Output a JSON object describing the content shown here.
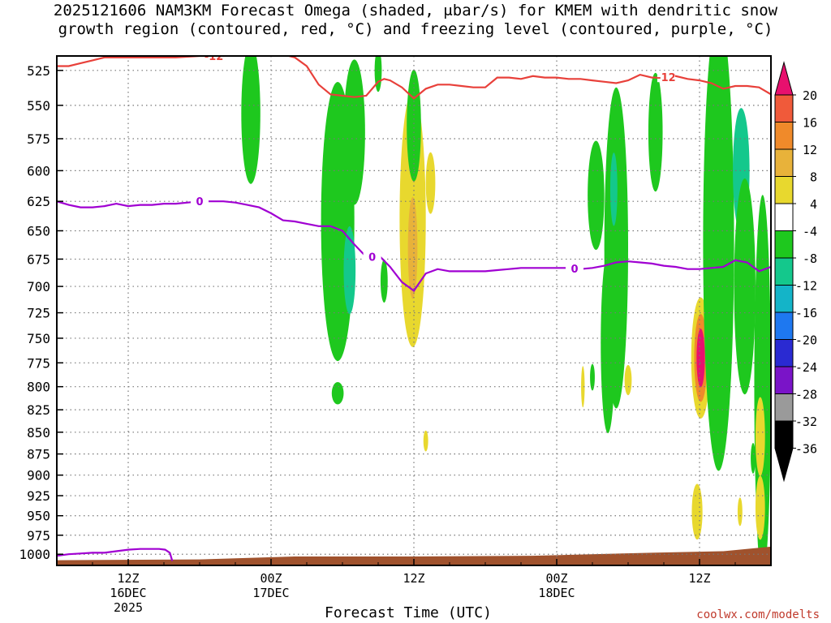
{
  "title": {
    "line1": "2025121606 NAM3KM Forecast Omega (shaded, μbar/s) for KMEM with dendritic snow",
    "line2": "growth region (contoured, red, °C) and freezing level (contoured, purple, °C)"
  },
  "credit": "coolwx.com/modelts",
  "chart_data": {
    "type": "heatmap",
    "xlabel": "Forecast Time (UTC)",
    "ylabel": "",
    "x_units": "forecast hour",
    "xlim": [
      0,
      60
    ],
    "ylim": [
      1015,
      515
    ],
    "y_ticks": [
      525,
      550,
      575,
      600,
      625,
      650,
      675,
      700,
      725,
      750,
      775,
      800,
      825,
      850,
      875,
      900,
      925,
      950,
      975,
      1000
    ],
    "x_ticks": [
      {
        "hour": 6,
        "lines": [
          "12Z",
          "16DEC",
          "2025"
        ]
      },
      {
        "hour": 18,
        "lines": [
          "00Z",
          "17DEC"
        ]
      },
      {
        "hour": 30,
        "lines": [
          "12Z"
        ]
      },
      {
        "hour": 42,
        "lines": [
          "00Z",
          "18DEC"
        ]
      },
      {
        "hour": 54,
        "lines": [
          "12Z"
        ]
      }
    ],
    "grid": true,
    "colorbar": {
      "levels": [
        20,
        16,
        12,
        8,
        4,
        -4,
        -8,
        -12,
        -16,
        -20,
        -24,
        -28,
        -32,
        -36
      ],
      "colors": [
        "#e8106e",
        "#f05a3a",
        "#f08a2a",
        "#e8b23a",
        "#e8d82e",
        "#ffffff",
        "#1ec81e",
        "#14c88c",
        "#14b4c8",
        "#1e78f0",
        "#2a2ad2",
        "#7a14c8",
        "#9a9a9a",
        "#000000"
      ]
    },
    "series": [
      {
        "name": "-12",
        "color": "#e8403a",
        "x": [
          0,
          1,
          2,
          3,
          4,
          6,
          8,
          10,
          12,
          14,
          16,
          18,
          19,
          20,
          21,
          22,
          23,
          24,
          25,
          26,
          27,
          27.5,
          28,
          29,
          30,
          31,
          32,
          33,
          34,
          35,
          36,
          37,
          38,
          39,
          40,
          41,
          42,
          43,
          44,
          45,
          46,
          47,
          48,
          49,
          50,
          51,
          52,
          53,
          54,
          55,
          56,
          57,
          58,
          59,
          60
        ],
        "y": [
          522,
          522,
          520,
          518,
          516,
          516,
          516,
          516,
          515,
          515,
          514,
          514,
          514,
          516,
          522,
          535,
          542,
          543,
          544,
          543,
          533,
          531,
          532,
          537,
          545,
          538,
          535,
          535,
          536,
          537,
          537,
          530,
          530,
          531,
          529,
          530,
          530,
          531,
          531,
          532,
          533,
          534,
          532,
          528,
          530,
          530,
          529,
          531,
          532,
          534,
          538,
          536,
          536,
          537,
          542
        ]
      },
      {
        "name": "0",
        "color": "#a000d2",
        "x": [
          0,
          1,
          2,
          3,
          4,
          5,
          6,
          7,
          8,
          9,
          10,
          11,
          12,
          13,
          14,
          15,
          16,
          17,
          18,
          19,
          20,
          21,
          22,
          23,
          24,
          25,
          26,
          26.5,
          27,
          28,
          29,
          30,
          31,
          32,
          33,
          34,
          35,
          36,
          37,
          38,
          39,
          40,
          41,
          42,
          43,
          44,
          45,
          46,
          47,
          48,
          49,
          50,
          51,
          52,
          53,
          54,
          55,
          56,
          57,
          58,
          59,
          60
        ],
        "y": [
          625,
          628,
          630,
          630,
          629,
          627,
          629,
          628,
          628,
          627,
          627,
          626,
          625,
          625,
          625,
          626,
          628,
          630,
          635,
          641,
          642,
          644,
          646,
          646,
          650,
          662,
          673,
          673,
          671,
          682,
          696,
          704,
          688,
          684,
          686,
          686,
          686,
          686,
          685,
          684,
          683,
          683,
          683,
          683,
          683,
          684,
          683,
          681,
          678,
          677,
          678,
          679,
          681,
          682,
          684,
          684,
          683,
          682,
          676,
          678,
          686,
          682
        ]
      },
      {
        "name": "0b",
        "color": "#a000d2",
        "x": [
          0,
          1,
          2,
          3,
          4,
          5,
          6,
          7,
          8,
          8.6,
          9.1,
          9.5,
          9.7
        ],
        "y": [
          1002,
          1000,
          999,
          998,
          998,
          996,
          994,
          993,
          993,
          993,
          994,
          998,
          1009
        ]
      }
    ]
  },
  "blobs": [
    {
      "x": 16.3,
      "y": 556,
      "rx": 0.8,
      "ry": 52,
      "color": "#1ec81e"
    },
    {
      "x": 23.6,
      "y": 642,
      "rx": 1.4,
      "ry": 118,
      "color": "#1ec81e"
    },
    {
      "x": 25.0,
      "y": 570,
      "rx": 0.9,
      "ry": 55,
      "color": "#1ec81e"
    },
    {
      "x": 24.6,
      "y": 685,
      "rx": 0.5,
      "ry": 40,
      "color": "#14c88c"
    },
    {
      "x": 23.6,
      "y": 807,
      "rx": 0.5,
      "ry": 12,
      "color": "#1ec81e"
    },
    {
      "x": 29.9,
      "y": 640,
      "rx": 1.1,
      "ry": 108,
      "color": "#e8d82e"
    },
    {
      "x": 29.9,
      "y": 665,
      "rx": 0.4,
      "ry": 45,
      "color": "#e8b23a"
    },
    {
      "x": 30.0,
      "y": 565,
      "rx": 0.6,
      "ry": 42,
      "color": "#1ec81e"
    },
    {
      "x": 27.0,
      "y": 525,
      "rx": 0.3,
      "ry": 15,
      "color": "#1ec81e"
    },
    {
      "x": 27.5,
      "y": 695,
      "rx": 0.3,
      "ry": 20,
      "color": "#1ec81e"
    },
    {
      "x": 31.4,
      "y": 610,
      "rx": 0.4,
      "ry": 25,
      "color": "#e8d82e"
    },
    {
      "x": 31.0,
      "y": 860,
      "rx": 0.2,
      "ry": 12,
      "color": "#e8d82e"
    },
    {
      "x": 45.3,
      "y": 620,
      "rx": 0.7,
      "ry": 45,
      "color": "#1ec81e"
    },
    {
      "x": 47.0,
      "y": 665,
      "rx": 1.0,
      "ry": 140,
      "color": "#1ec81e"
    },
    {
      "x": 46.8,
      "y": 615,
      "rx": 0.3,
      "ry": 30,
      "color": "#14c88c"
    },
    {
      "x": 46.3,
      "y": 755,
      "rx": 0.6,
      "ry": 90,
      "color": "#1ec81e"
    },
    {
      "x": 45.0,
      "y": 790,
      "rx": 0.2,
      "ry": 14,
      "color": "#1ec81e"
    },
    {
      "x": 44.2,
      "y": 800,
      "rx": 0.15,
      "ry": 22,
      "color": "#e8d82e"
    },
    {
      "x": 50.3,
      "y": 570,
      "rx": 0.6,
      "ry": 45,
      "color": "#1ec81e"
    },
    {
      "x": 48.0,
      "y": 793,
      "rx": 0.3,
      "ry": 16,
      "color": "#e8d82e"
    },
    {
      "x": 54.1,
      "y": 770,
      "rx": 0.8,
      "ry": 62,
      "color": "#e8d82e"
    },
    {
      "x": 54.1,
      "y": 770,
      "rx": 0.55,
      "ry": 45,
      "color": "#f08a2a"
    },
    {
      "x": 54.1,
      "y": 770,
      "rx": 0.35,
      "ry": 30,
      "color": "#e8106e"
    },
    {
      "x": 53.8,
      "y": 945,
      "rx": 0.45,
      "ry": 35,
      "color": "#e8d82e"
    },
    {
      "x": 55.6,
      "y": 660,
      "rx": 1.3,
      "ry": 195,
      "color": "#1ec81e"
    },
    {
      "x": 57.5,
      "y": 600,
      "rx": 0.7,
      "ry": 50,
      "color": "#14c88c"
    },
    {
      "x": 57.8,
      "y": 700,
      "rx": 0.9,
      "ry": 100,
      "color": "#1ec81e"
    },
    {
      "x": 59.3,
      "y": 800,
      "rx": 0.7,
      "ry": 200,
      "color": "#1ec81e"
    },
    {
      "x": 59.1,
      "y": 855,
      "rx": 0.4,
      "ry": 45,
      "color": "#e8d82e"
    },
    {
      "x": 59.1,
      "y": 940,
      "rx": 0.4,
      "ry": 40,
      "color": "#e8d82e"
    },
    {
      "x": 57.4,
      "y": 945,
      "rx": 0.2,
      "ry": 18,
      "color": "#e8d82e"
    },
    {
      "x": 58.5,
      "y": 880,
      "rx": 0.2,
      "ry": 18,
      "color": "#1ec81e"
    }
  ],
  "ground": {
    "color": "#a0522d",
    "x": [
      0,
      12,
      20,
      30,
      40,
      50,
      56,
      60
    ],
    "y": [
      1008,
      1007,
      1003,
      1003,
      1002,
      998,
      996,
      990
    ]
  }
}
